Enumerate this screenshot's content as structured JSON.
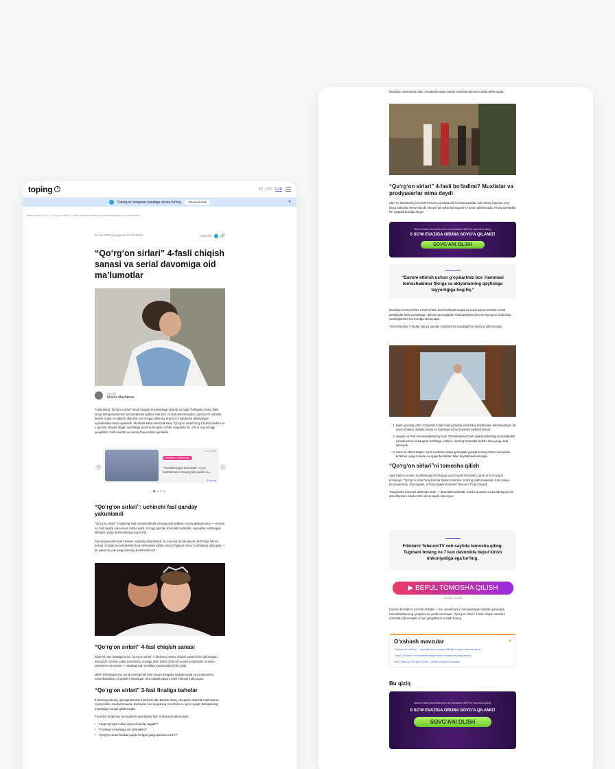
{
  "header": {
    "logo": "toping",
    "lang_ru": "РУ",
    "lang_uz": "O'Z",
    "lang_uzl": "UZB"
  },
  "banner": {
    "text": "Toping.uz telegram-kanaliga obuna bo'ling",
    "button": "Obuna bo'lish"
  },
  "breadcrumb": "Bosh sahifa  /  Kino  /  \"Qo'rg'on sirlari\" 4-fasli chiqish sanasi va serial davomiga oid ma'lumotlar",
  "article": {
    "date": "23.05.2025 (yangilandi 21.06.2025)",
    "share_label": "Ulashish",
    "title": "“Qoʻrgʻon sirlari” 4-fasli chiqish sanasi va serial davomiga oid maʼlumotlar",
    "author_role": "Muallif",
    "author_name": "Musha Mashkova",
    "intro": "Turkiyaning \"Qo'rg'on sirlari\" serial haqiqiy sensatsiyaga aylandi va faqat Turkiyada emas, balki uning tashqarisida ham tomoshabinlar qalbini zabt etdi. Go'zal dekoratsiyalar, qamrovchi obrazlar, keskin syujet va iqtidorli aktyorlar uni so'nggi yillarning eng ko'p muhokama qilinayotgan loyihalaridan biriga aylantirdi. Muxlislar katta sabrsizlik bilan \"Qo'rg'on sirlari\"ning 4-fasli bo'ladimi va u qachon chiqadi degan savollarga javob kutmoqda. Ushbu maqolada siz uchun eng so'nggi yangiliklar, mish-mishlar va rasmiy bayonotlarni jamladik.",
    "slider": {
      "badge": "Kinoteatr - media arxiv",
      "date": "10.12.2025",
      "text": "\"Yondirilmagan kinoteatr\": Avva boshlanishni chaqirg'ida gadilir va...",
      "link": "Ko'proq"
    },
    "h_s3": "“Qoʻrgʻon sirlari”: uchinchi fasl qanday yakunlandi",
    "p_s3a": "\"Qo'rg'on sirlari\" 3-faslining finali tomoshabinlarni hayajonda qoldirdi. Asosiy qahramonlar — Seyran va Ferit taqdiri yana savol ostida qoldi. So'nggi qismlar dramatik burilishlar, siyosatlar, kutilmagan ittifoqlar, yangi dushmanlarga boy bo'ldi.",
    "p_s3b": "Ssenariynavislar faslni keskin nuqtada yakunlashdi, bu esa eng tarzda davom bo'lishiga ishora beradi. Ko'plab tomoshabinlar final zahmasida aslida nima bo'lganini hanuz muhokama qilmoqda — bu yakunmi yoki yangi bobning boshlanishimi?",
    "h_date": "“Qoʻrgʻon sirlari” 4-fasl chiqish sanasi",
    "p_date1": "2025-yil may holatiga ko'ra, \"Qo'rg'on sirlari\" 4-faslining rasmiy chiqish sanasi e'lon qilinmagan. Biroq turk OAVlari xabar berishicha, suratga olish ishlari 2025-yil yozida boshlanishi mumkin, premyera esa kuzda — odatdagi turk seriallari mavsumida bo'lib o'tadi.",
    "p_date2": "Mish-mishlarga ko'ra, serial reytingi hali ham yuqori darajada saqlanmoqda va prodyuserlar tomoshabinlarni yo'qotishni istamaydi. Shu sababli davom etish ehtimoli juda yuqori.",
    "h_final": "“Qoʻrgʻon sirlari” 3-fasl finaliga baholar",
    "p_final": "3-faslning yakuniy qismiga baholar turlicha bo'ldi. Ba'zilar hissiy chuqurlik, aktyorlik mahorati va rejissyorlikni maqtashmoqda, boshqalar esa syujetning cho'zilishi va ayrim syujet chiziqlarining mantiqligini tanqid qilishmoqda.",
    "p_forum": "Forumlar va ijtimoiy tarmoqlarda quyidagilar faol muhokama qilinmoqda:",
    "bullets": [
      "\"Nega Qo'rg'on sirlari ayran shunday tugadi?\"",
      "\"Feritning o'rnishdagi siri ochiladimi?\"",
      "\"Qo'rg'on sirlari finalida paydo bo'lgan yangi qahramon kim?\""
    ]
  },
  "right": {
    "top_p": "Muxlislar nazariyalar bilan o'rtoqlashmoqda va fasl ravishda davomini talab qilishmoqda.",
    "h_prod": "“Qoʻrgʻon sirlari” 4-fasli boʻladimi? Muxlislar va prodyuserlar nima deydi",
    "p_prod": "Star TV telekanali yoki OGM Pictures prodyuserlik kompaniyasidan hali rasmiy bayonot yo'q. Biroq aktyorlar intervyularida hikoya hali yakunlanmaganini ma'lum qilishmoqda. Prodyuserlardan biri yaqinda bunday degan:",
    "promo": {
      "l1": "Butun hafta davomida kino va seriallarni BEPUL tomosha qiling",
      "l2": "0 SO'M EVAZIGA OBUNA SOVG'A QILAMIZ!",
      "cta": "SOVG'ANI OLISH"
    },
    "quote1": "“Davom ettirish uchun g‘oyalarimiz bor. Hammasi tomoshabinlar fikriga va aktyorlarning qaytishga tayyorligiga bog‘liq.”",
    "p_after_q": "Muxlislar ishonch bilan 4-fasl bo'ladi, deb hisoblashmoqda va serial davom etishini so'rab petitsiyalar ham yaratishgan. Ijtimoiy tarmoqlarda #YaliCapkiniDevam va #Qo'rg'on sirlari4fasl xeshteglari tez-tez trendga chiqmoqda.",
    "p_expect": "Tomoshabinlar 4-faslda hikoya qanday rivojlanishini quyidagicha tasavvur qilishmoqda:",
    "list": [
      "Halis-ag'aning o'limi: Ko'pchilik 4-fasl Halis-ag'aning vafoti bilan boshlanadi, deb hisoblaydi. Bu esa Korhanlar oilasida meros va hokimiyat uchun kurashni boshlab beradi.",
      "Seyran va Ferit munosabatlarining rivoji: Tomoshabinlar bosh qahramonlarning munosabatlari yanada yetuk va barqaror bo'lishiga, ehtimol, ularning farzandlar bo'lishi ham yangi umid qilmoqda.",
      "Suna va Abidin taqdiri: Ayrim muxlislar ularning hikoyasi yanada ko'proq e'tibor markazida bo'lishini, yangi sinovlar va syujet burilishlari bilan boyitilishini kutmoqda."
    ],
    "h_watch": "“Qoʻrgʻon sirlari”ni tomosha qilish",
    "p_watch1": "Agar hali bu serialni boshlamagan bo'lsangiz yoki sevimli lahzalarni yana bir ko'rmoqchi bo'lsangiz, \"Qo'rg'on sirlari\"ning barcha fasllari mashhur striming platformalarida, turk onlayn-kinoteatrlarida, shuningdek, o'zbek onlayn-kinoteatri Telecom TVda mavjud.",
    "p_watch2": "Yangi faslni tomosha qilishdan oldin — dramatik burilishlar, nozik romantika va serialning go'zal atmosferasini eslab o'tish uchun ajoyib imkoniyat.",
    "quote2": "Filmlarni TelecomTV veb-saytida tomosha qiling. Tugmani bosing va 7 kun davomida bepul kirish imkoniyatiga ega bo‘ling.",
    "watch_btn": "BEPUL TOMOSHA QILISH",
    "watch_sub": "yangilik sifatida",
    "p_end": "Davomi bo'ladimi? Ko'rinib turibdiki — ha. Serial hanuz ommalashgan holatda qolmoqda, tomoshabinlarning qiziqishi esa oshib bormoqda. \"Qo'rg'on sirlari\" 4-fasli chiqish sanasini e'tiborda yubormaslik uchun yangiliklarni kuzatib boring.",
    "similar": {
      "title": "O‘xshash mavzular",
      "items": [
        "\"Sukhan va bebaho\" - dramatik serial haqida ikkinchi bo'lgan hamma narsa",
        "\"Layla\" 26-qism: munosabatlardagi burilish nuqtasi va yangi fitnalar",
        "Asru: Sizning 150 qism, 8-fasl - tavsifi va asosiy voqealar"
      ]
    },
    "h_interest": "Bu qiziq",
    "promo2": {
      "l1": "Butun hafta davomida kino va seriallarni BEPUL tomosha qiling",
      "l2": "0 SO'M EVAZIGA OBUNA SOVG'A QILAMIZ!",
      "cta": "SOVG'ANI OLISH"
    }
  },
  "colors": {
    "accent": "#6b4dd6",
    "telegram": "#2a9fd9",
    "promo_bg": "#3a1560",
    "cta_green": "#8edc45",
    "watch_from": "#e83c63",
    "watch_to": "#9a2be0"
  }
}
